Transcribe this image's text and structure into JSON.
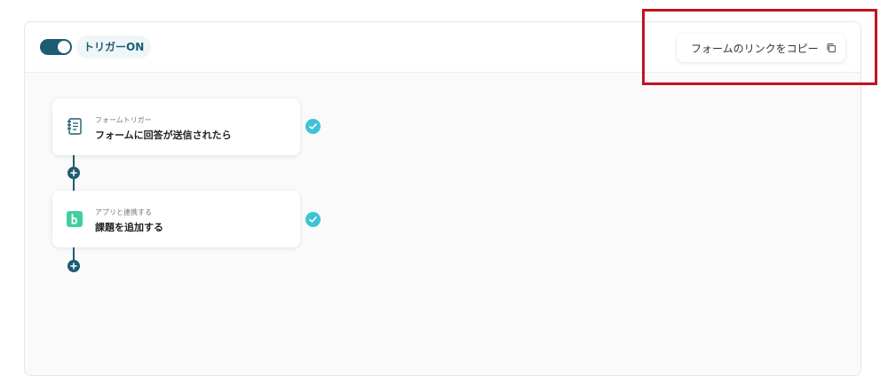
{
  "header": {
    "toggle_state": "on",
    "trigger_label": "トリガーON",
    "copy_button_label": "フォームのリンクをコピー"
  },
  "flow": {
    "steps": [
      {
        "subtitle": "フォームトリガー",
        "title": "フォームに回答が送信されたら",
        "icon": "form-document-icon",
        "status": "complete"
      },
      {
        "subtitle": "アプリと連携する",
        "title": "課題を追加する",
        "icon": "backlog-app-icon",
        "status": "complete"
      }
    ]
  },
  "colors": {
    "primary": "#1e5c72",
    "check": "#3cc3d6",
    "app_icon": "#42ce9f",
    "highlight": "#c0141e"
  }
}
